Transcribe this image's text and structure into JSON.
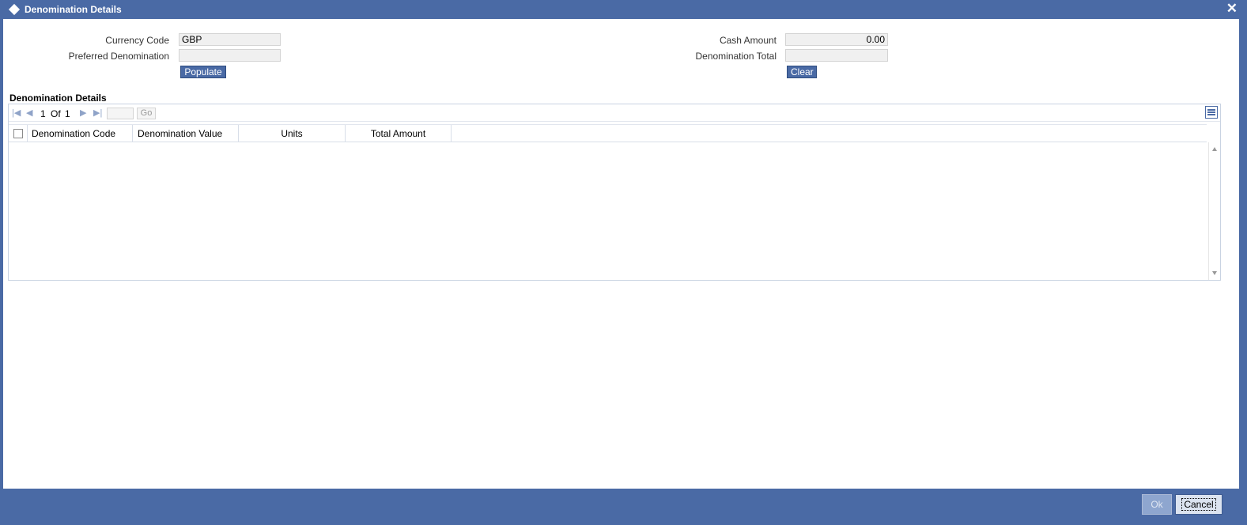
{
  "window": {
    "title": "Denomination Details",
    "close_glyph": "✕",
    "title_icon": "diamond-icon",
    "accent_color": "#4a6aa5"
  },
  "form": {
    "currency_code_label": "Currency Code",
    "currency_code_value": "GBP",
    "preferred_denomination_label": "Preferred Denomination",
    "preferred_denomination_value": "",
    "populate_button": "Populate",
    "cash_amount_label": "Cash Amount",
    "cash_amount_value": "0.00",
    "denomination_total_label": "Denomination Total",
    "denomination_total_value": "",
    "clear_button": "Clear"
  },
  "grid": {
    "section_title": "Denomination Details",
    "pager": {
      "current_page": "1",
      "of_label": "Of",
      "total_pages": "1",
      "go_label": "Go",
      "page_input_value": ""
    },
    "columns": [
      {
        "label": "Denomination Code"
      },
      {
        "label": "Denomination Value"
      },
      {
        "label": "Units"
      },
      {
        "label": "Total Amount"
      }
    ],
    "rows": []
  },
  "footer": {
    "ok_button": "Ok",
    "cancel_button": "Cancel"
  }
}
